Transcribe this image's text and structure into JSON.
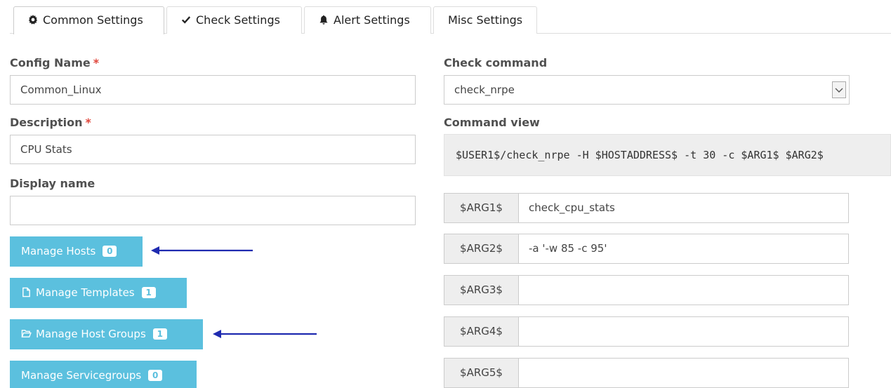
{
  "tabs": [
    {
      "label": "Common Settings",
      "icon": "gear-icon",
      "active": true
    },
    {
      "label": "Check Settings",
      "icon": "checkmark-icon",
      "active": false
    },
    {
      "label": "Alert Settings",
      "icon": "bell-icon",
      "active": false
    },
    {
      "label": "Misc Settings",
      "icon": "",
      "active": false
    }
  ],
  "form": {
    "config_name": {
      "label": "Config Name",
      "required_mark": "*",
      "value": "Common_Linux"
    },
    "description": {
      "label": "Description",
      "required_mark": "*",
      "value": "CPU Stats"
    },
    "display_name": {
      "label": "Display name",
      "value": ""
    }
  },
  "buttons": [
    {
      "label": "Manage Hosts",
      "icon": "",
      "badge": "0"
    },
    {
      "label": "Manage Templates",
      "icon": "file-icon",
      "badge": "1"
    },
    {
      "label": "Manage Host Groups",
      "icon": "folder-open-icon",
      "badge": "1"
    },
    {
      "label": "Manage Servicegroups",
      "icon": "",
      "badge": "0"
    }
  ],
  "check": {
    "command_label": "Check command",
    "command_value": "check_nrpe",
    "view_label": "Command view",
    "view_value": "$USER1$/check_nrpe -H $HOSTADDRESS$ -t 30 -c $ARG1$ $ARG2$",
    "args": [
      {
        "name": "$ARG1$",
        "value": "check_cpu_stats"
      },
      {
        "name": "$ARG2$",
        "value": "-a '-w 85 -c 95'"
      },
      {
        "name": "$ARG3$",
        "value": ""
      },
      {
        "name": "$ARG4$",
        "value": ""
      },
      {
        "name": "$ARG5$",
        "value": ""
      }
    ]
  },
  "colors": {
    "button_bg": "#5bc0de",
    "required_mark": "#e0463b",
    "annotation_arrow": "#1f2bb0"
  }
}
